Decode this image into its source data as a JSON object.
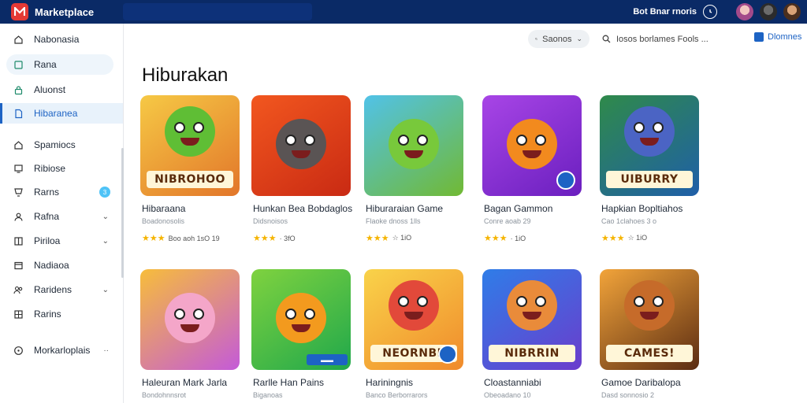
{
  "app": {
    "title": "Marketplace"
  },
  "topbar": {
    "user_label": "Bot Bnar rnoris"
  },
  "sidebar": {
    "items": [
      {
        "label": "Nabonasia",
        "icon": "home-icon"
      },
      {
        "label": "Rana",
        "icon": "page-icon"
      },
      {
        "label": "Aluonst",
        "icon": "lock-icon"
      },
      {
        "label": "Hibaranea",
        "icon": "document-icon"
      },
      {
        "label": "Spamiocs",
        "icon": "home-icon"
      },
      {
        "label": "Ribiose",
        "icon": "monitor-icon"
      },
      {
        "label": "Rarns",
        "icon": "cup-icon",
        "badge": "3"
      },
      {
        "label": "Rafna",
        "icon": "person-icon"
      },
      {
        "label": "Piriloa",
        "icon": "book-icon"
      },
      {
        "label": "Nadiaoa",
        "icon": "box-icon"
      },
      {
        "label": "Raridens",
        "icon": "people-icon"
      },
      {
        "label": "Rarins",
        "icon": "grid-icon"
      },
      {
        "label": "Morkarloplais",
        "icon": "info-icon"
      }
    ]
  },
  "toolbar": {
    "filter_label": "Saonos",
    "search_text": "Iosos borlames Fools ...",
    "action_label": "Dlomnes"
  },
  "page": {
    "title": "Hiburakan"
  },
  "cards": [
    {
      "name": "Hibaraana",
      "sub": "Boadonosolis",
      "stars": "★★★",
      "meta": "Boo aoh 1sO 19",
      "banner": "NIBROHOO",
      "colors": [
        "#f6c945",
        "#e2762a"
      ],
      "creature": "#5fbe35"
    },
    {
      "name": "Hunkan Bea Bobdaglos",
      "sub": "Didsnoisos",
      "stars": "★★★",
      "meta": "·  3fO",
      "banner": "",
      "colors": [
        "#f2571f",
        "#c92a13"
      ],
      "creature": "#5a5454"
    },
    {
      "name": "Hiburaraian Game",
      "sub": "Flaoke dnoss 1lls",
      "stars": "★★★",
      "meta": "☆  1iO",
      "banner": "",
      "colors": [
        "#51c2e8",
        "#71b933"
      ],
      "creature": "#78c93b"
    },
    {
      "name": "Bagan Gammon",
      "sub": "Conre aoab 29",
      "stars": "★★★",
      "meta": "·  1iO",
      "banner": "",
      "colors": [
        "#a845e6",
        "#6a1fbf"
      ],
      "creature": "#f28a1e"
    },
    {
      "name": "Hapkian Bopltiahos",
      "sub": "Cao 1clahoes 3 o",
      "stars": "★★★",
      "meta": "☆  1iO",
      "banner": "UIBURRY",
      "colors": [
        "#2f8a4a",
        "#1f5fa8"
      ],
      "creature": "#4b64c4"
    },
    {
      "name": "Haleuran Mark Jarla",
      "sub": "Bondohnnsrot",
      "stars": "",
      "meta": "",
      "banner": "",
      "colors": [
        "#f7bd3b",
        "#c45ad8"
      ],
      "creature": "#f4a6c9"
    },
    {
      "name": "Rarlle Han Pains",
      "sub": "Biganoas",
      "stars": "",
      "meta": "",
      "banner": "",
      "colors": [
        "#7fd23f",
        "#20a84b"
      ],
      "creature": "#f39a1e"
    },
    {
      "name": "Hariningnis",
      "sub": "Banco Berborrarors",
      "stars": "",
      "meta": "",
      "banner": "NEORNBE",
      "colors": [
        "#f9d34a",
        "#f08a2b"
      ],
      "creature": "#e2493a"
    },
    {
      "name": "Cloastanniabi",
      "sub": "Obeoadano 10",
      "stars": "",
      "meta": "",
      "banner": "NIBRRIN",
      "colors": [
        "#2f7de8",
        "#6b3ccc"
      ],
      "creature": "#e98b3a"
    },
    {
      "name": "Gamoe Daribalopa",
      "sub": "Dasd sonnosio 2",
      "stars": "",
      "meta": "",
      "banner": "CAMES!",
      "colors": [
        "#f2a43a",
        "#5b2c12"
      ],
      "creature": "#c66b2a"
    }
  ]
}
